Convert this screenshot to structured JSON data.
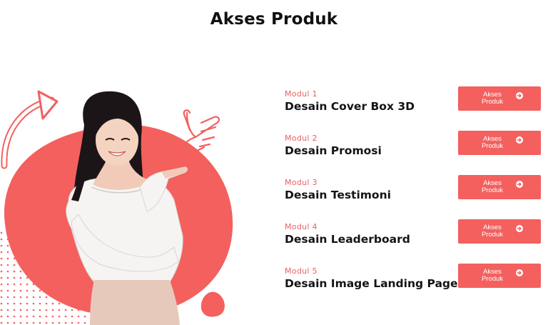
{
  "page": {
    "title": "Akses Produk"
  },
  "colors": {
    "accent": "#f3605e",
    "label": "#e8615f",
    "text": "#141414"
  },
  "modules": [
    {
      "label": "Modul 1",
      "title": "Desain Cover Box 3D",
      "button": "Akses Produk",
      "button_icon": "arrow-right-circle-icon"
    },
    {
      "label": "Modul 2",
      "title": "Desain Promosi",
      "button": "Akses Produk",
      "button_icon": "arrow-right-circle-icon"
    },
    {
      "label": "Modul 3",
      "title": "Desain Testimoni",
      "button": "Akses Produk",
      "button_icon": "arrow-right-circle-icon"
    },
    {
      "label": "Modul 4",
      "title": "Desain Leaderboard",
      "button": "Akses Produk",
      "button_icon": "arrow-right-circle-icon"
    },
    {
      "label": "Modul 5",
      "title": "Desain Image Landing Page",
      "button": "Akses Produk",
      "button_icon": "arrow-right-circle-icon"
    }
  ]
}
